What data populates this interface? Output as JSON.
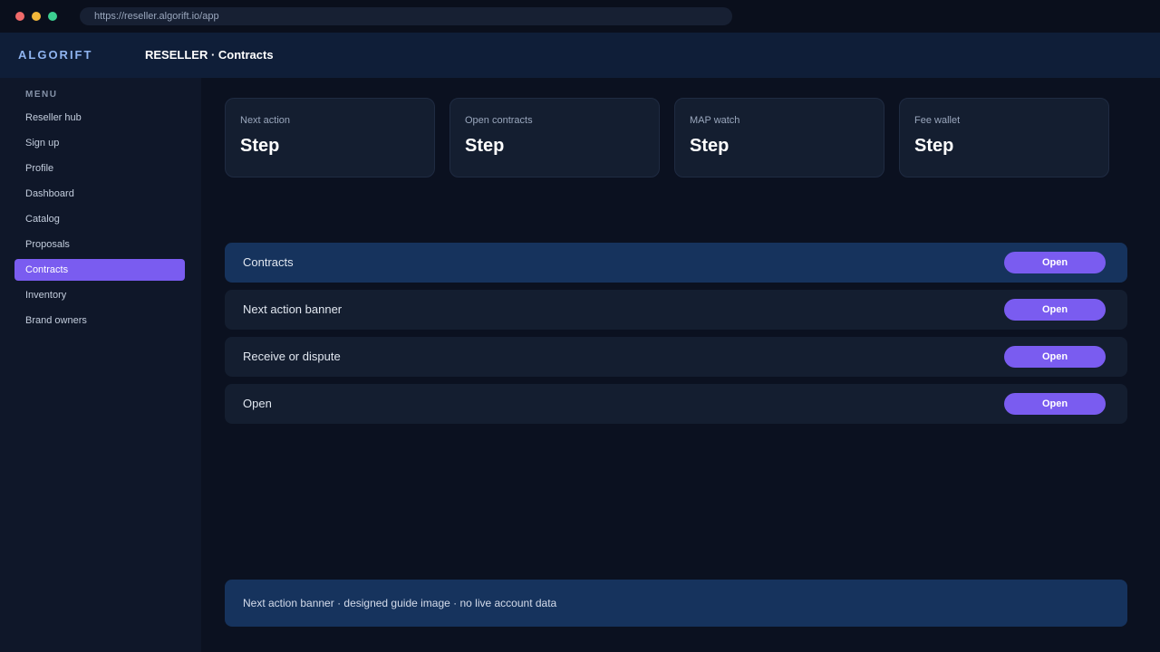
{
  "browser": {
    "url": "https://reseller.algorift.io/app"
  },
  "header": {
    "brand": "ALGORIFT",
    "title": "RESELLER · Contracts"
  },
  "sidebar": {
    "heading": "MENU",
    "items": [
      {
        "label": "Reseller hub"
      },
      {
        "label": "Sign up"
      },
      {
        "label": "Profile"
      },
      {
        "label": "Dashboard"
      },
      {
        "label": "Catalog"
      },
      {
        "label": "Proposals"
      },
      {
        "label": "Contracts",
        "active": true
      },
      {
        "label": "Inventory"
      },
      {
        "label": "Brand owners"
      }
    ]
  },
  "cards": [
    {
      "label": "Next action",
      "value": "Step"
    },
    {
      "label": "Open contracts",
      "value": "Step"
    },
    {
      "label": "MAP watch",
      "value": "Step"
    },
    {
      "label": "Fee wallet",
      "value": "Step"
    }
  ],
  "rows": [
    {
      "label": "Contracts",
      "button": "Open"
    },
    {
      "label": "Next action banner",
      "button": "Open"
    },
    {
      "label": "Receive or dispute",
      "button": "Open"
    },
    {
      "label": "Open",
      "button": "Open"
    }
  ],
  "footer": {
    "text": "Next action banner · designed guide image · no live account data"
  },
  "colors": {
    "accent": "#7a5cf0",
    "highlight": "#16335d",
    "background": "#0b1120"
  }
}
